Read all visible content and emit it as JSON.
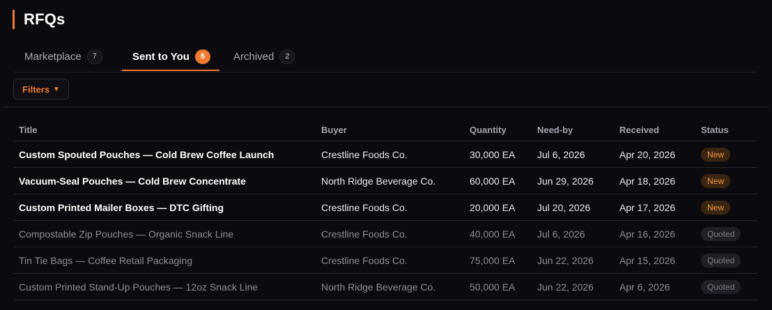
{
  "page": {
    "title": "RFQs"
  },
  "tabs": [
    {
      "label": "Marketplace",
      "count": "7"
    },
    {
      "label": "Sent to You",
      "count": "6"
    },
    {
      "label": "Archived",
      "count": "2"
    }
  ],
  "active_tab": "Sent to You",
  "filters": {
    "label": "Filters",
    "caret": "▼"
  },
  "table": {
    "columns": [
      "Title",
      "Buyer",
      "Quantity",
      "Need-by",
      "Received",
      "Status"
    ],
    "rows": [
      {
        "title": "Custom Spouted Pouches — Cold Brew Coffee Launch",
        "buyer": "Crestline Foods Co.",
        "quantity": "30,000 EA",
        "need_by": "Jul 6, 2026",
        "received": "Apr 20, 2026",
        "status": "New"
      },
      {
        "title": "Vacuum-Seal Pouches — Cold Brew Concentrate",
        "buyer": "North Ridge Beverage Co.",
        "quantity": "60,000 EA",
        "need_by": "Jun 29, 2026",
        "received": "Apr 18, 2026",
        "status": "New"
      },
      {
        "title": "Custom Printed Mailer Boxes — DTC Gifting",
        "buyer": "Crestline Foods Co.",
        "quantity": "20,000 EA",
        "need_by": "Jul 20, 2026",
        "received": "Apr 17, 2026",
        "status": "New"
      },
      {
        "title": "Compostable Zip Pouches — Organic Snack Line",
        "buyer": "Crestline Foods Co.",
        "quantity": "40,000 EA",
        "need_by": "Jul 6, 2026",
        "received": "Apr 16, 2026",
        "status": "Quoted"
      },
      {
        "title": "Tin Tie Bags — Coffee Retail Packaging",
        "buyer": "Crestline Foods Co.",
        "quantity": "75,000 EA",
        "need_by": "Jun 22, 2026",
        "received": "Apr 15, 2026",
        "status": "Quoted"
      },
      {
        "title": "Custom Printed Stand-Up Pouches — 12oz Snack Line",
        "buyer": "North Ridge Beverage Co.",
        "quantity": "50,000 EA",
        "need_by": "Jun 22, 2026",
        "received": "Apr 6, 2026",
        "status": "Quoted"
      }
    ]
  },
  "colors": {
    "accent": "#f07a2f",
    "background": "#0b0b0f",
    "new_badge": "#f59a3e",
    "quoted_badge": "#7d7d87"
  }
}
